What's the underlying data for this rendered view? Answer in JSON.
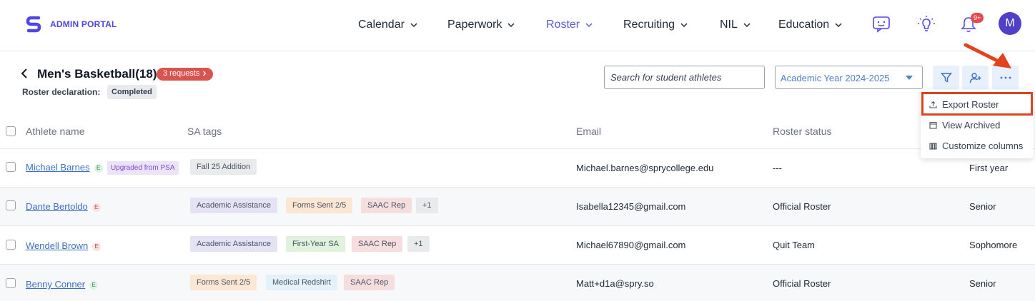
{
  "brand": {
    "name": "ADMIN PORTAL",
    "accent": "#4f46e5"
  },
  "nav": {
    "items": [
      {
        "label": "Calendar"
      },
      {
        "label": "Paperwork"
      },
      {
        "label": "Roster"
      },
      {
        "label": "Recruiting"
      },
      {
        "label": "NIL"
      },
      {
        "label": "Education"
      }
    ],
    "icons": [
      "chat-icon",
      "lightbulb-icon",
      "bell-icon"
    ],
    "notification_count": "9+",
    "avatar_initial": "M"
  },
  "header": {
    "title": "Men's Basketball(18)",
    "requests_label": "3 requests",
    "declaration_label": "Roster declaration:",
    "declaration_status": "Completed"
  },
  "toolbar": {
    "search_placeholder": "Search for student athletes",
    "year_value": "Academic Year 2024-2025"
  },
  "menu": {
    "items": [
      {
        "label": "Export Roster",
        "icon": "upload-icon"
      },
      {
        "label": "View Archived",
        "icon": "archive-icon"
      },
      {
        "label": "Customize columns",
        "icon": "columns-icon"
      }
    ]
  },
  "table": {
    "columns": [
      "Athlete name",
      "SA tags",
      "Email",
      "Roster status"
    ],
    "rows": [
      {
        "name": "Michael Barnes",
        "e_badge": "E",
        "extra_badge": "Upgraded from PSA",
        "tags": [
          "Fall 25 Addition"
        ],
        "more": "",
        "email": "Michael.barnes@sprycollege.edu",
        "status": "---",
        "year": "First year"
      },
      {
        "name": "Dante Bertoldo",
        "e_badge": "E",
        "extra_badge": "",
        "tags": [
          "Academic Assistance",
          "Forms Sent 2/5",
          "SAAC Rep"
        ],
        "more": "+1",
        "email": "Isabella12345@gmail.com",
        "status": "Official Roster",
        "year": "Senior"
      },
      {
        "name": "Wendell Brown",
        "e_badge": "E",
        "extra_badge": "",
        "tags": [
          "Academic Assistance",
          "First-Year SA",
          "SAAC Rep"
        ],
        "more": "+1",
        "email": "Michael67890@gmail.com",
        "status": "Quit Team",
        "year": "Sophomore"
      },
      {
        "name": "Benny Conner",
        "e_badge": "E",
        "extra_badge": "",
        "tags": [
          "Forms Sent 2/5",
          "Medical Redshirt",
          "SAAC Rep"
        ],
        "more": "",
        "email": "Matt+d1a@spry.so",
        "status": "Official Roster",
        "year": "Senior"
      }
    ]
  },
  "colors": {
    "highlight": "#d9451d",
    "link": "#3b6fc0",
    "requests_badge": "#d9534f"
  }
}
